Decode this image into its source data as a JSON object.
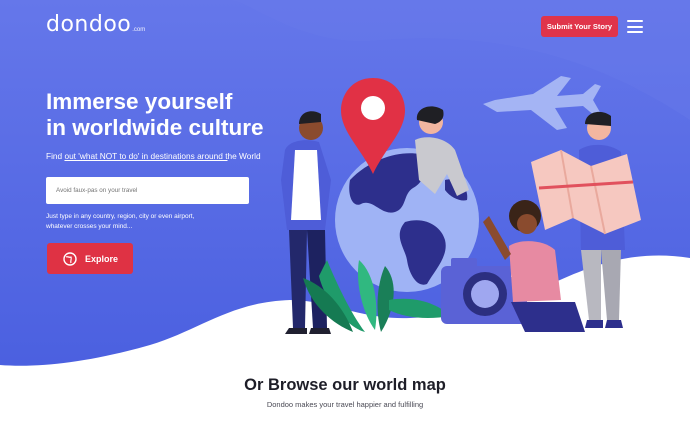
{
  "logo": {
    "word": "dondoo",
    "tld": ".com"
  },
  "header": {
    "submit_label": "Submit Your Story"
  },
  "hero": {
    "headline_line1": "Immerse yourself",
    "headline_line2": "in worldwide culture",
    "tagline_pre": "Find ",
    "tagline_link1": "out 'what NOT to do' in destinations around t",
    "tagline_mid": "he World",
    "search_placeholder": "Avoid faux-pas on your travel",
    "hint_line1": "Just type in any country, region, city or even airport,",
    "hint_line2": "whatever crosses your mind...",
    "explore_label": "Explore"
  },
  "browse": {
    "title": "Or Browse our world map",
    "subtitle": "Dondoo makes your travel happier and fulfilling"
  },
  "colors": {
    "hero_top": "#5b6ee9",
    "hero_bottom": "#4b5fe0",
    "accent_red": "#e0344a",
    "white": "#ffffff"
  },
  "icons": [
    "menu-icon",
    "map-pin-icon",
    "globe-icon",
    "airplane-icon",
    "camera-icon",
    "plant-icon",
    "map-icon",
    "explore-globe-icon"
  ]
}
